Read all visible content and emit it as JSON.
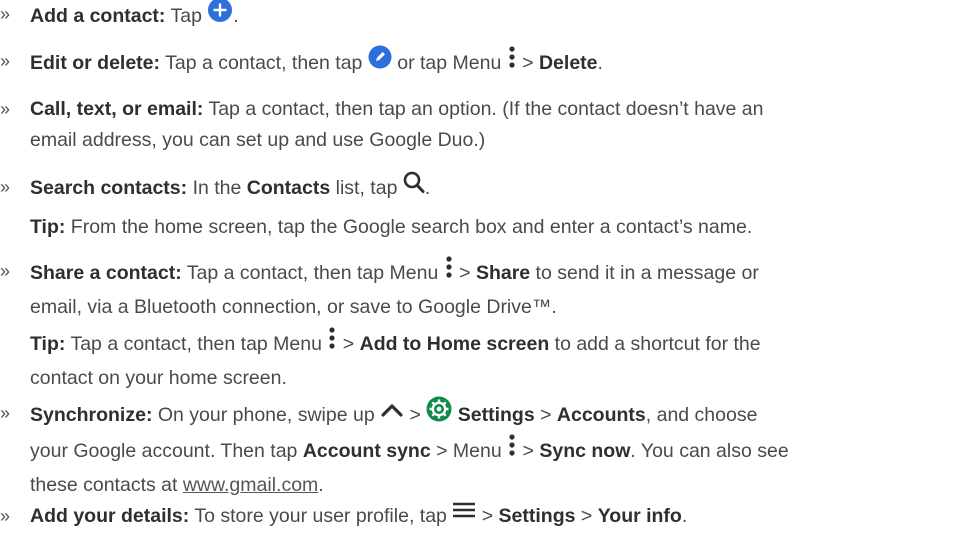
{
  "bullet": "»",
  "items": [
    {
      "label": "Add a contact:",
      "t1": " Tap ",
      "t2": "."
    },
    {
      "label": "Edit or delete:",
      "t1": " Tap a contact, then tap ",
      "t2": " or tap Menu ",
      "t3": " > ",
      "b1": "Delete",
      "t4": "."
    },
    {
      "label": "Call, text, or email:",
      "t1": " Tap a contact, then tap an option. (If the contact doesn’t have an",
      "line2": "email address, you can set up and use Google Duo.)"
    },
    {
      "label": "Search contacts:",
      "t1": " In the ",
      "b1": "Contacts",
      "t2": " list, tap ",
      "t3": "."
    },
    {
      "tip": "Tip:",
      "t1": " From the home screen, tap the Google search box and enter a contact’s name."
    },
    {
      "label": "Share a contact:",
      "t1": " Tap a contact, then tap Menu ",
      "t2": " > ",
      "b1": "Share",
      "t3": " to send it in a message or",
      "line2": "email, via a Bluetooth connection, or save to Google Drive™."
    },
    {
      "tip": "Tip:",
      "t1": " Tap a contact, then tap Menu ",
      "t2": " > ",
      "b1": "Add to Home screen",
      "t3": " to add a shortcut for the",
      "line2": "contact on your home screen."
    },
    {
      "label": "Synchronize:",
      "t1": " On your phone, swipe up ",
      "t2": " > ",
      "b1": "Settings",
      "t3": " > ",
      "b2": "Accounts",
      "t4": ", and choose",
      "l2a": "your Google account. Then tap ",
      "l2b1": "Account sync",
      "l2b": " > Menu ",
      "l2c": " > ",
      "l2b2": "Sync now",
      "l2d": ". You can also see",
      "l3a": "these contacts at ",
      "link": "www.gmail.com",
      "l3b": "."
    },
    {
      "label": "Add your details:",
      "t1": " To store your user profile, tap ",
      "t2": " > ",
      "b1": "Settings",
      "t3": " > ",
      "b2": "Your info",
      "t4": "."
    }
  ],
  "colors": {
    "accent": "#2f6fdc",
    "settings": "#0f8a4a",
    "text": "#4a4a4a"
  }
}
